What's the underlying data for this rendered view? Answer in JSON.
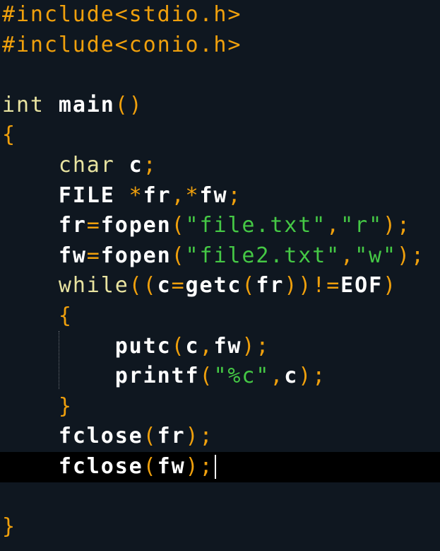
{
  "editor": {
    "current_line": 16,
    "lines": [
      [
        [
          "#include<stdio.h>",
          "pp"
        ]
      ],
      [
        [
          "#include<conio.h>",
          "pp"
        ]
      ],
      [],
      [
        [
          "int ",
          "kw"
        ],
        [
          "main",
          "id"
        ],
        [
          "()",
          "pn"
        ]
      ],
      [
        [
          "{",
          "pn"
        ]
      ],
      [
        [
          "    ",
          ""
        ],
        [
          "char ",
          "kw"
        ],
        [
          "c",
          "id"
        ],
        [
          ";",
          "pn"
        ]
      ],
      [
        [
          "    ",
          ""
        ],
        [
          "FILE ",
          "id"
        ],
        [
          "*",
          "pn"
        ],
        [
          "fr",
          "id"
        ],
        [
          ",*",
          "pn"
        ],
        [
          "fw",
          "id"
        ],
        [
          ";",
          "pn"
        ]
      ],
      [
        [
          "    ",
          ""
        ],
        [
          "fr",
          "id"
        ],
        [
          "=",
          "pn"
        ],
        [
          "fopen",
          "id"
        ],
        [
          "(",
          "pn"
        ],
        [
          "\"file.txt\"",
          "st"
        ],
        [
          ",",
          "pn"
        ],
        [
          "\"r\"",
          "st"
        ],
        [
          ");",
          "pn"
        ]
      ],
      [
        [
          "    ",
          ""
        ],
        [
          "fw",
          "id"
        ],
        [
          "=",
          "pn"
        ],
        [
          "fopen",
          "id"
        ],
        [
          "(",
          "pn"
        ],
        [
          "\"file2.txt\"",
          "st"
        ],
        [
          ",",
          "pn"
        ],
        [
          "\"w\"",
          "st"
        ],
        [
          ");",
          "pn"
        ]
      ],
      [
        [
          "    ",
          ""
        ],
        [
          "while",
          "kw"
        ],
        [
          "((",
          "pn"
        ],
        [
          "c",
          "id"
        ],
        [
          "=",
          "pn"
        ],
        [
          "getc",
          "id"
        ],
        [
          "(",
          "pn"
        ],
        [
          "fr",
          "id"
        ],
        [
          "))!=",
          "pn"
        ],
        [
          "EOF",
          "id"
        ],
        [
          ")",
          "pn"
        ]
      ],
      [
        [
          "    ",
          ""
        ],
        [
          "{",
          "pn"
        ]
      ],
      [
        [
          "        ",
          ""
        ],
        [
          "putc",
          "id"
        ],
        [
          "(",
          "pn"
        ],
        [
          "c",
          "id"
        ],
        [
          ",",
          "pn"
        ],
        [
          "fw",
          "id"
        ],
        [
          ");",
          "pn"
        ]
      ],
      [
        [
          "        ",
          ""
        ],
        [
          "printf",
          "id"
        ],
        [
          "(",
          "pn"
        ],
        [
          "\"%c\"",
          "st"
        ],
        [
          ",",
          "pn"
        ],
        [
          "c",
          "id"
        ],
        [
          ");",
          "pn"
        ]
      ],
      [
        [
          "    ",
          ""
        ],
        [
          "}",
          "pn"
        ]
      ],
      [
        [
          "    ",
          ""
        ],
        [
          "fclose",
          "id"
        ],
        [
          "(",
          "pn"
        ],
        [
          "fr",
          "id"
        ],
        [
          ");",
          "pn"
        ]
      ],
      [
        [
          "    ",
          ""
        ],
        [
          "fclose",
          "id"
        ],
        [
          "(",
          "pn"
        ],
        [
          "fw",
          "id"
        ],
        [
          ");",
          "pn"
        ]
      ],
      [],
      [
        [
          "}",
          "pn"
        ]
      ]
    ]
  }
}
